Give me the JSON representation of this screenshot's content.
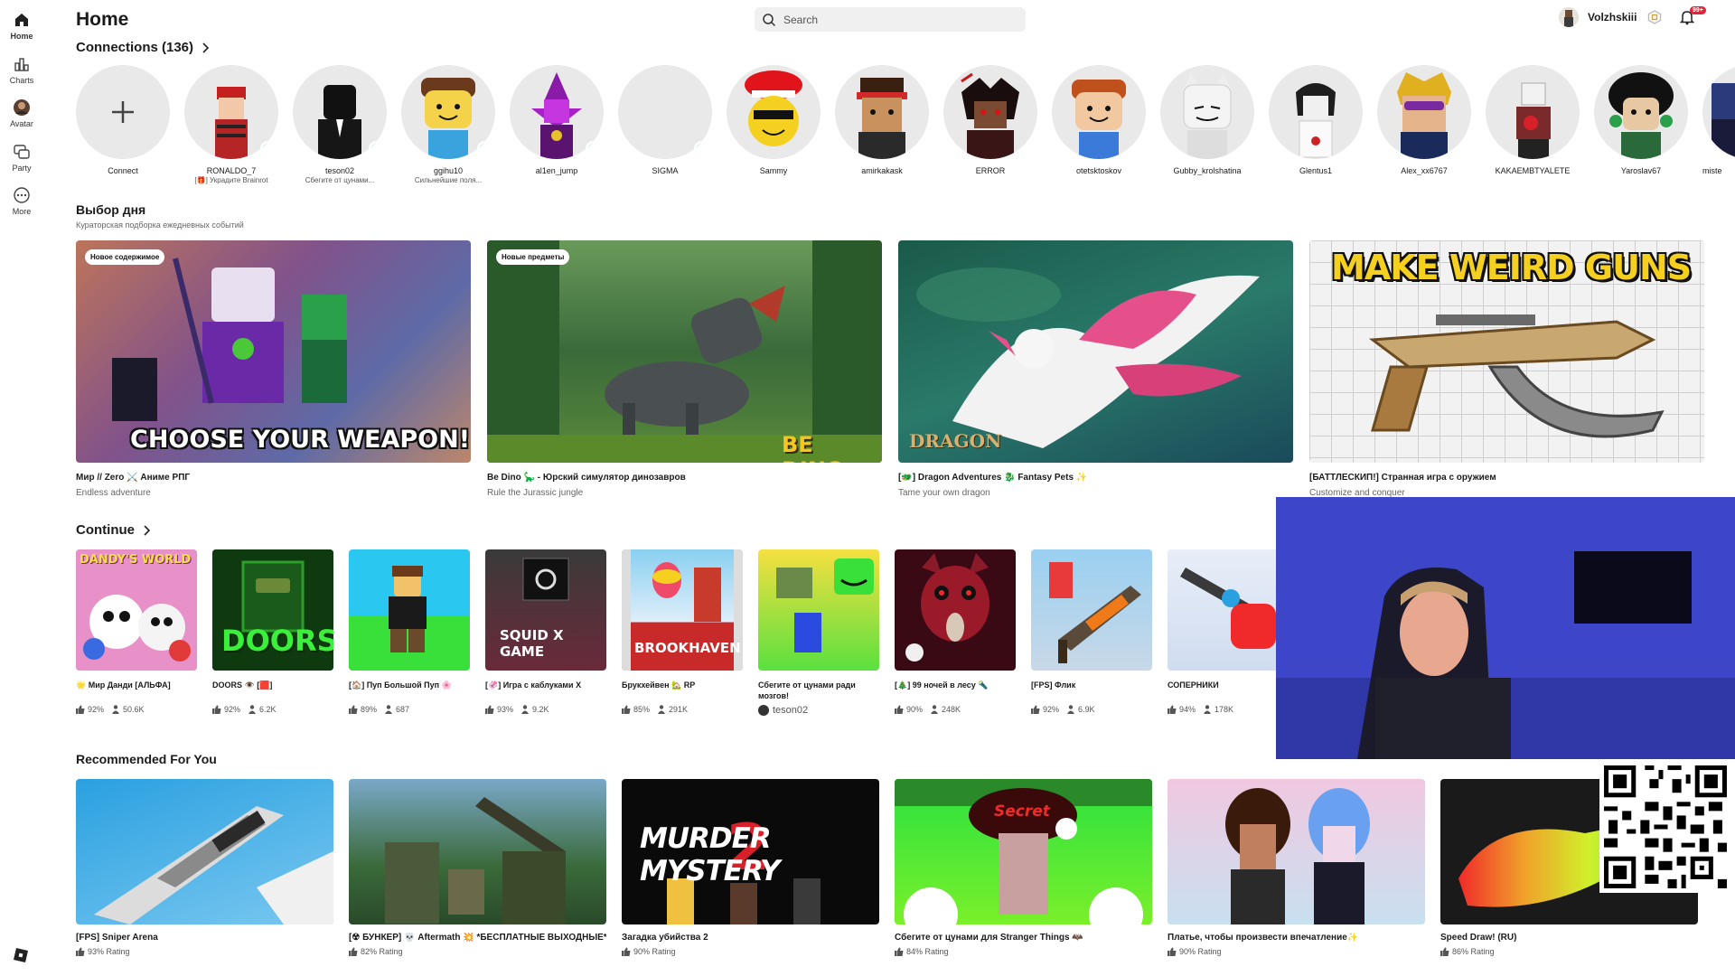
{
  "sidebar": {
    "items": [
      {
        "label": "Home",
        "icon": "home-icon"
      },
      {
        "label": "Charts",
        "icon": "charts-icon"
      },
      {
        "label": "Avatar",
        "icon": "avatar-icon"
      },
      {
        "label": "Party",
        "icon": "party-icon"
      },
      {
        "label": "More",
        "icon": "more-icon"
      }
    ]
  },
  "header": {
    "title": "Home",
    "search_placeholder": "Search",
    "username": "Volzhskiii",
    "notification_badge": "99+"
  },
  "connections": {
    "title": "Connections (136)",
    "items": [
      {
        "name": "Connect",
        "status": ""
      },
      {
        "name": "RONALDO_7",
        "status": "[🎁] Украдите Brainrot",
        "online": true
      },
      {
        "name": "teson02",
        "status": "Сбегите от цунами...",
        "online": true
      },
      {
        "name": "ggihu10",
        "status": "Сильнейшие поля...",
        "online": true
      },
      {
        "name": "al1en_jump",
        "status": "",
        "online": true
      },
      {
        "name": "SIGMA",
        "status": "",
        "online": true
      },
      {
        "name": "Sammy",
        "status": ""
      },
      {
        "name": "amirkakask",
        "status": ""
      },
      {
        "name": "ERROR",
        "status": ""
      },
      {
        "name": "otetsktoskov",
        "status": ""
      },
      {
        "name": "Gubby_krolshatina",
        "status": ""
      },
      {
        "name": "Glentus1",
        "status": ""
      },
      {
        "name": "Alex_xx6767",
        "status": ""
      },
      {
        "name": "KAKAEMBTYALETE",
        "status": ""
      },
      {
        "name": "Yaroslav67",
        "status": ""
      },
      {
        "name": "miste",
        "status": ""
      }
    ]
  },
  "featured": {
    "title": "Выбор дня",
    "subtitle": "Кураторская подборка ежедневных событий",
    "items": [
      {
        "tag": "Новое содержимое",
        "title": "Мир // Zero ⚔️ Аниме РПГ",
        "subtitle": "Endless adventure",
        "overlay": "CHOOSE YOUR WEAPON!"
      },
      {
        "tag": "Новые предметы",
        "title": "Be Dino 🦕 - Юрский симулятор динозавров",
        "subtitle": "Rule the Jurassic jungle",
        "overlay": "BE DINO"
      },
      {
        "tag": "",
        "title": "[🐲] Dragon Adventures 🐉 Fantasy Pets ✨",
        "subtitle": "Tame your own dragon",
        "overlay": "DRAGON"
      },
      {
        "tag": "",
        "title": "[БАТТЛЕСКИП!] Странная игра с оружием",
        "subtitle": "Customize and conquer",
        "overlay": "MAKE WEIRD GUNS"
      }
    ]
  },
  "continue": {
    "title": "Continue",
    "items": [
      {
        "name": "🌟 Мир Данди [АЛЬФА]",
        "rating": "92%",
        "players": "50.6K",
        "label": "DANDY'S WORLD"
      },
      {
        "name": "DOORS 👁️ [🟥]",
        "rating": "92%",
        "players": "6.2K",
        "label": "DOORS"
      },
      {
        "name": "[🏠] Пуп Большой Пуп 🌸",
        "rating": "89%",
        "players": "687",
        "label": ""
      },
      {
        "name": "[🦑] Игра с каблуками X",
        "rating": "93%",
        "players": "9.2K",
        "label": "SQUID X GAME"
      },
      {
        "name": "Брукхейвен 🏡 RP",
        "rating": "85%",
        "players": "291K",
        "label": "BROOKHAVEN"
      },
      {
        "name": "Сбегите от цунами ради мозгов!",
        "creator": "teson02",
        "label": ""
      },
      {
        "name": "[🎄] 99 ночей в лесу 🔦",
        "rating": "90%",
        "players": "248K",
        "label": ""
      },
      {
        "name": "[FPS] Флик",
        "rating": "92%",
        "players": "6.9K",
        "label": ""
      },
      {
        "name": "СОПЕРНИКИ",
        "rating": "94%",
        "players": "178K",
        "label": ""
      }
    ]
  },
  "recommended": {
    "title": "Recommended For You",
    "items": [
      {
        "name": "[FPS] Sniper Arena",
        "rating": "93% Rating"
      },
      {
        "name": "[☢ БУНКЕР] 💀 Aftermath 💥 *БЕСПЛАТНЫЕ ВЫХОДНЫЕ*",
        "rating": "82% Rating"
      },
      {
        "name": "Загадка убийства 2",
        "rating": "90% Rating",
        "overlay": "MURDER MYSTERY"
      },
      {
        "name": "Сбегите от цунами для Stranger Things 🦇",
        "rating": "84% Rating",
        "overlay": "Secret"
      },
      {
        "name": "Платье, чтобы произвести впечатление✨",
        "rating": "90% Rating"
      },
      {
        "name": "Speed Draw! (RU)",
        "rating": "86% Rating"
      }
    ]
  }
}
